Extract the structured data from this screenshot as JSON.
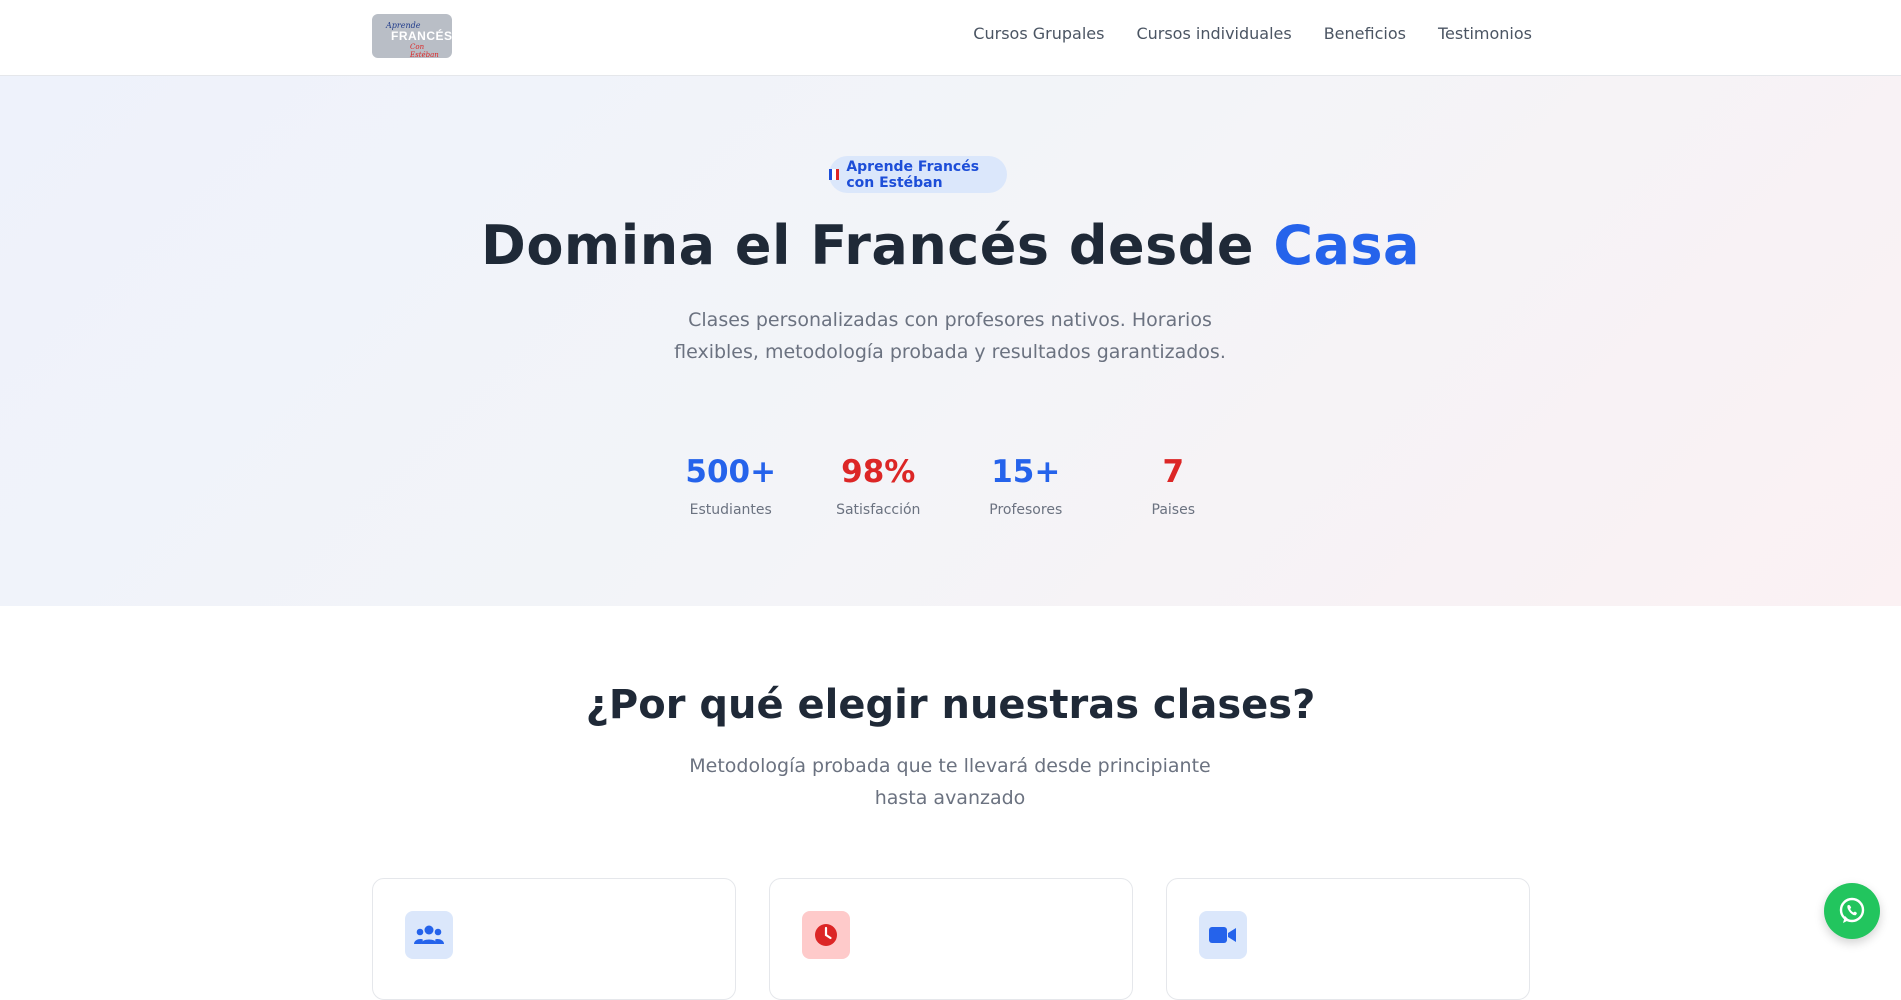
{
  "header": {
    "logo": {
      "line1": "Aprende",
      "line2": "FRANCÉS",
      "line3": "Con Estéban"
    },
    "nav": [
      "Cursos Grupales",
      "Cursos individuales",
      "Beneficios",
      "Testimonios"
    ]
  },
  "hero": {
    "badge_flag": "france-flag-icon",
    "badge": "Aprende Francés con Estéban",
    "title_main": "Domina el Francés desde ",
    "title_accent": "Casa",
    "subtitle": "Clases personalizadas con profesores nativos. Horarios flexibles, metodología probada y resultados garantizados.",
    "stats": [
      {
        "value": "500+",
        "label": "Estudiantes",
        "color": "#2563eb"
      },
      {
        "value": "98%",
        "label": "Satisfacción",
        "color": "#dc2626"
      },
      {
        "value": "15+",
        "label": "Profesores",
        "color": "#2563eb"
      },
      {
        "value": "7",
        "label": "Paises",
        "color": "#dc2626"
      }
    ]
  },
  "why": {
    "title": "¿Por qué elegir nuestras clases?",
    "subtitle": "Metodología probada que te llevará desde principiante hasta avanzado",
    "cards": [
      {
        "icon": "users-icon",
        "icon_bg": "#dbe7fb",
        "icon_color": "#2563eb"
      },
      {
        "icon": "clock-icon",
        "icon_bg": "#fecaca",
        "icon_color": "#dc2626"
      },
      {
        "icon": "video-icon",
        "icon_bg": "#dbe7fb",
        "icon_color": "#2563eb"
      }
    ]
  },
  "whatsapp": {
    "icon": "whatsapp-icon"
  },
  "colors": {
    "primary": "#2563eb",
    "accent_red": "#dc2626",
    "whatsapp": "#22c55e"
  }
}
